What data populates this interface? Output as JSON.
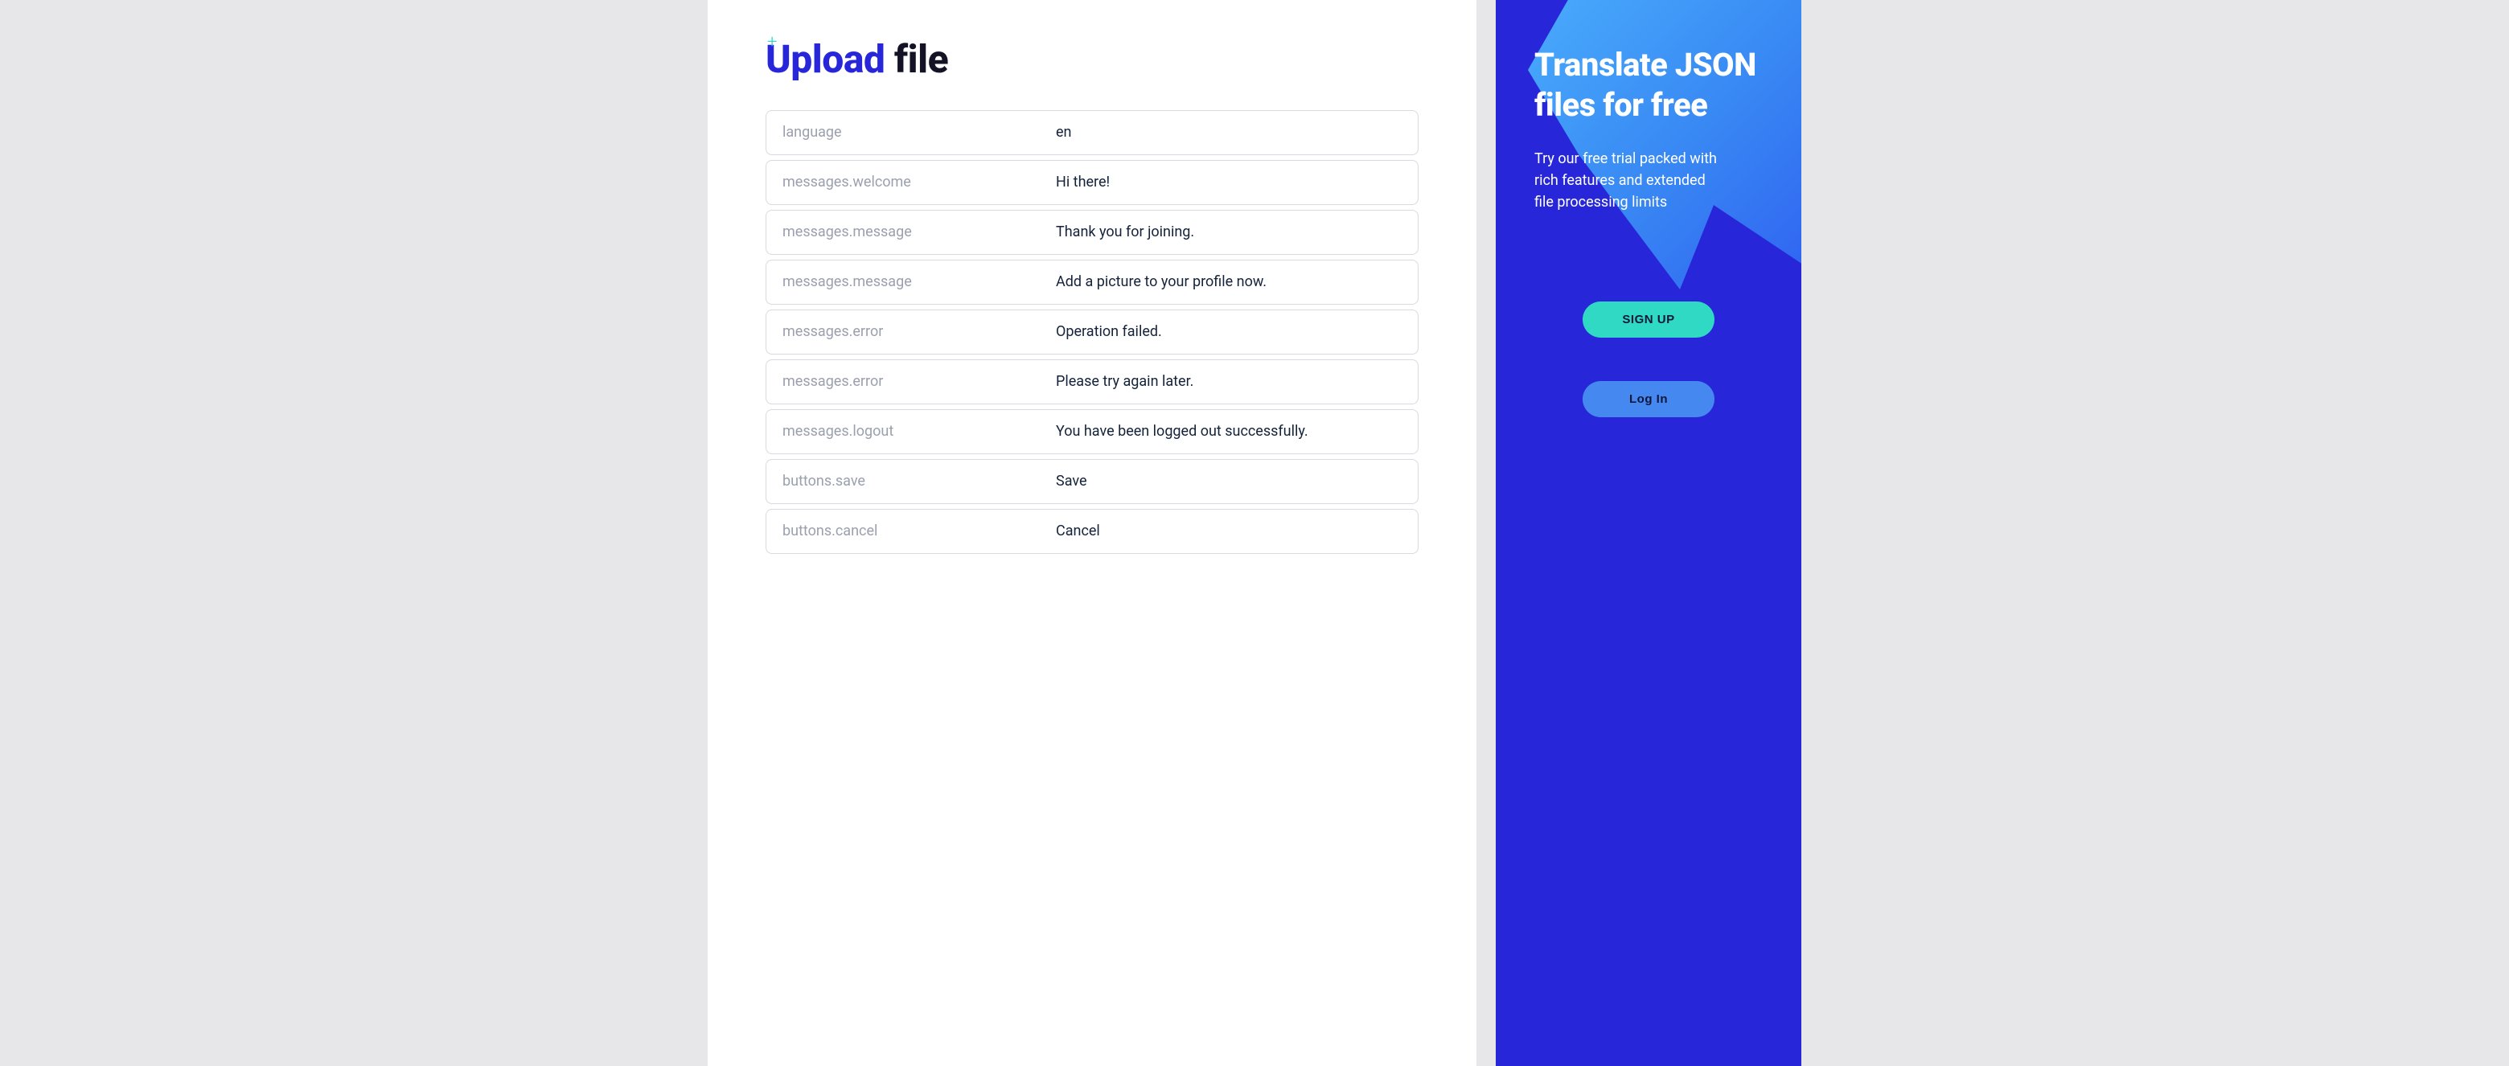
{
  "main": {
    "title_upload": "Upload",
    "title_file": "file",
    "rows": [
      {
        "key": "language",
        "value": "en"
      },
      {
        "key": "messages.welcome",
        "value": "Hi there!"
      },
      {
        "key": "messages.message",
        "value": "Thank you for joining."
      },
      {
        "key": "messages.message",
        "value": "Add a picture to your profile now."
      },
      {
        "key": "messages.error",
        "value": "Operation failed."
      },
      {
        "key": "messages.error",
        "value": "Please try again later."
      },
      {
        "key": "messages.logout",
        "value": "You have been logged out successfully."
      },
      {
        "key": "buttons.save",
        "value": "Save"
      },
      {
        "key": "buttons.cancel",
        "value": "Cancel"
      }
    ]
  },
  "sidebar": {
    "title": "Translate JSON files for free",
    "subtitle": "Try our free trial packed with rich features and extended file processing limits",
    "signup_label": "SIGN UP",
    "login_label": "Log In"
  }
}
